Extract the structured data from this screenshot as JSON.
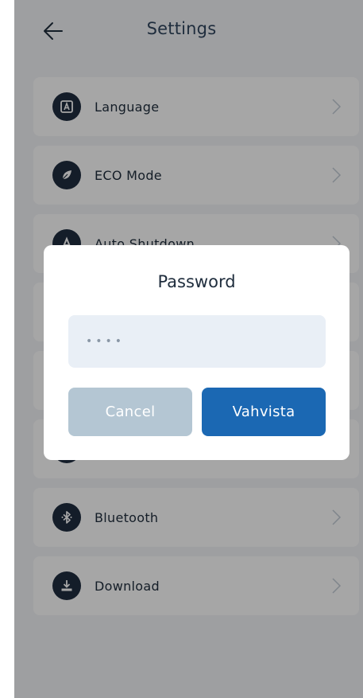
{
  "header": {
    "title": "Settings",
    "back_icon": "arrow-left-icon"
  },
  "settings_items": [
    {
      "label": "Language",
      "icon": "language-icon"
    },
    {
      "label": "ECO Mode",
      "icon": "leaf-icon"
    },
    {
      "label": "Auto Shutdown",
      "icon": "auto-shutdown-icon"
    },
    {
      "label": "",
      "icon": ""
    },
    {
      "label": "",
      "icon": ""
    },
    {
      "label": "",
      "icon": ""
    },
    {
      "label": "Bluetooth",
      "icon": "bluetooth-icon"
    },
    {
      "label": "Download",
      "icon": "download-icon"
    }
  ],
  "dialog": {
    "title": "Password",
    "password_value": "••••",
    "cancel_label": "Cancel",
    "confirm_label": "Vahvista"
  },
  "colors": {
    "accent": "#1b68b3",
    "cancel": "#b4c6d3",
    "icon_bg": "#1f2d40",
    "input_bg": "#e9eff6"
  }
}
